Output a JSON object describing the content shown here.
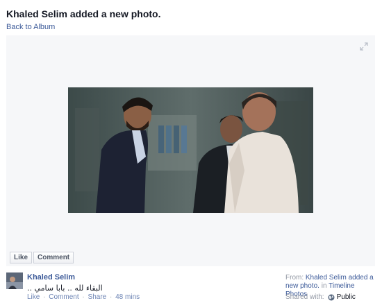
{
  "header": {
    "name": "Khaled Selim",
    "action": "added a new photo."
  },
  "nav": {
    "back_label": "Back to Album"
  },
  "stage": {
    "buttons": {
      "like": "Like",
      "comment": "Comment"
    }
  },
  "post": {
    "author": "Khaled Selim",
    "caption": "البقاء لله .. بابا سامي ..",
    "actions": {
      "like": "Like",
      "comment": "Comment",
      "share": "Share",
      "separator": "·",
      "time": "48 mins"
    },
    "from": {
      "prefix": "From:",
      "source": "Khaled Selim added a new photo.",
      "in_word": "in",
      "album": "Timeline Photos"
    },
    "shared": {
      "label": "Shared with:",
      "audience": "Public"
    }
  },
  "icons": {
    "expand": "expand-icon",
    "globe": "globe-icon"
  },
  "colors": {
    "link": "#3b5998",
    "muted": "#9197a3",
    "stage_bg": "#f6f7f9"
  }
}
